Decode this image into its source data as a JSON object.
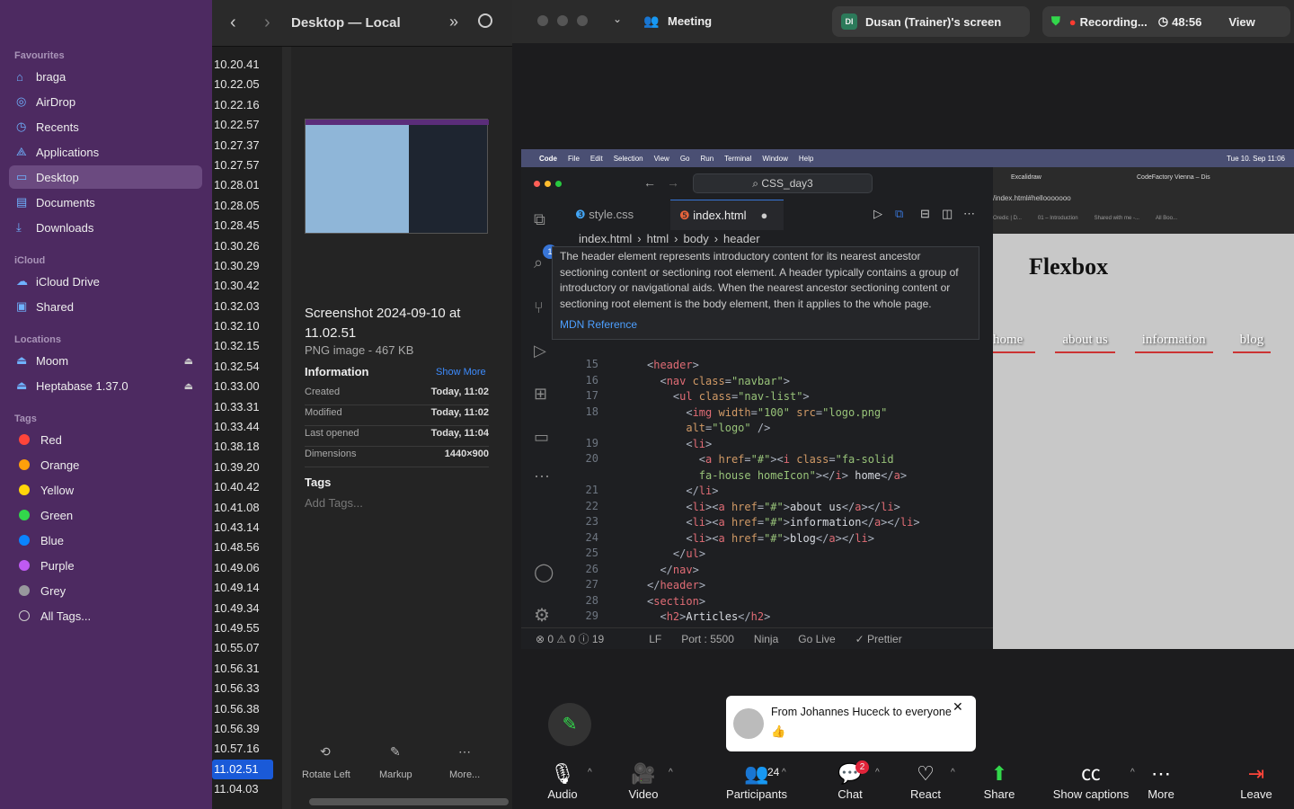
{
  "finder": {
    "title": "Desktop — Local",
    "sections": {
      "favourites": "Favourites",
      "icloud": "iCloud",
      "locations": "Locations",
      "tags": "Tags"
    },
    "favourites": [
      {
        "label": "braga",
        "icon": "home-icon"
      },
      {
        "label": "AirDrop",
        "icon": "airdrop-icon"
      },
      {
        "label": "Recents",
        "icon": "clock-icon"
      },
      {
        "label": "Applications",
        "icon": "applications-icon"
      },
      {
        "label": "Desktop",
        "icon": "desktop-icon"
      },
      {
        "label": "Documents",
        "icon": "document-icon"
      },
      {
        "label": "Downloads",
        "icon": "download-icon"
      }
    ],
    "icloud": [
      {
        "label": "iCloud Drive",
        "icon": "cloud-icon"
      },
      {
        "label": "Shared",
        "icon": "shared-folder-icon"
      }
    ],
    "locations": [
      {
        "label": "Moom",
        "icon": "disk-icon"
      },
      {
        "label": "Heptabase 1.37.0",
        "icon": "disk-icon"
      }
    ],
    "tags": [
      {
        "label": "Red",
        "color": "#ff453a"
      },
      {
        "label": "Orange",
        "color": "#ff9f0a"
      },
      {
        "label": "Yellow",
        "color": "#ffd60a"
      },
      {
        "label": "Green",
        "color": "#32d74b"
      },
      {
        "label": "Blue",
        "color": "#0a84ff"
      },
      {
        "label": "Purple",
        "color": "#bf5af2"
      },
      {
        "label": "Grey",
        "color": "#98989d"
      },
      {
        "label": "All Tags...",
        "color": ""
      }
    ],
    "files": [
      "10.20.41",
      "10.22.05",
      "10.22.16",
      "10.22.57",
      "10.27.37",
      "10.27.57",
      "10.28.01",
      "10.28.05",
      "10.28.45",
      "10.30.26",
      "10.30.29",
      "10.30.42",
      "10.32.03",
      "10.32.10",
      "10.32.15",
      "10.32.54",
      "10.33.00",
      "10.33.31",
      "10.33.44",
      "10.38.18",
      "10.39.20",
      "10.40.42",
      "10.41.08",
      "10.43.14",
      "10.48.56",
      "10.49.06",
      "10.49.14",
      "10.49.34",
      "10.49.55",
      "10.55.07",
      "10.56.31",
      "10.56.33",
      "10.56.38",
      "10.56.39",
      "10.57.16",
      "11.02.51",
      "11.04.03"
    ],
    "selected_file": "11.02.51",
    "preview": {
      "name": "Screenshot 2024-09-10 at 11.02.51",
      "kind": "PNG image - 467 KB",
      "info_label": "Information",
      "show_more": "Show More",
      "rows": [
        {
          "k": "Created",
          "v": "Today, 11:02"
        },
        {
          "k": "Modified",
          "v": "Today, 11:02"
        },
        {
          "k": "Last opened",
          "v": "Today, 11:04"
        },
        {
          "k": "Dimensions",
          "v": "1440×900"
        }
      ],
      "tags_label": "Tags",
      "add_tags": "Add Tags...",
      "actions": [
        "Rotate Left",
        "Markup",
        "More..."
      ]
    }
  },
  "zoom": {
    "meeting": "Meeting",
    "screen_share": "Dusan (Trainer)'s screen",
    "recording": "Recording...",
    "timer": "48:56",
    "view": "View",
    "chat_from": "From Johannes Huceck to everyone",
    "chat_msg": "👍",
    "toolbar": [
      {
        "label": "Audio"
      },
      {
        "label": "Video"
      },
      {
        "label": "Participants",
        "count": "24"
      },
      {
        "label": "Chat",
        "badge": "2"
      },
      {
        "label": "React"
      },
      {
        "label": "Share"
      },
      {
        "label": "Show captions"
      },
      {
        "label": "More"
      },
      {
        "label": "Leave"
      }
    ]
  },
  "vscode": {
    "menubar": [
      "Code",
      "File",
      "Edit",
      "Selection",
      "View",
      "Go",
      "Run",
      "Terminal",
      "Window",
      "Help"
    ],
    "clock": "Tue 10. Sep 11:06",
    "search": "CSS_day3",
    "tabs": [
      "style.css",
      "index.html"
    ],
    "breadcrumb": [
      "index.html",
      "html",
      "body",
      "header"
    ],
    "hover": "The header element represents introductory content for its nearest ancestor sectioning content or sectioning root element. A header typically contains a group of introductory or navigational aids. When the nearest ancestor sectioning content or sectioning root element is the body element, then it applies to the whole page.",
    "mdn": "MDN Reference",
    "line_numbers": [
      "15",
      "16",
      "17",
      "18",
      "",
      "19",
      "20",
      "",
      "21",
      "22",
      "23",
      "24",
      "25",
      "26",
      "27",
      "28",
      "29"
    ],
    "status": {
      "problems": "⊗ 0 ⚠ 0 ⓘ 19",
      "eol": "LF",
      "port": "Port : 5500",
      "ninja": "Ninja",
      "golive": "Go Live",
      "prettier": "✓ Prettier"
    }
  },
  "browser": {
    "tabs": [
      "Excalidraw",
      "CodeFactory Vienna – Dis"
    ],
    "url": "/index.html#hellooooooo",
    "bookmarks": [
      "Oredic | D...",
      "01 – Introduction",
      "Shared with me -...",
      "All Boo..."
    ],
    "heading": "Flexbox",
    "nav": [
      "home",
      "about us",
      "information",
      "blog"
    ]
  }
}
